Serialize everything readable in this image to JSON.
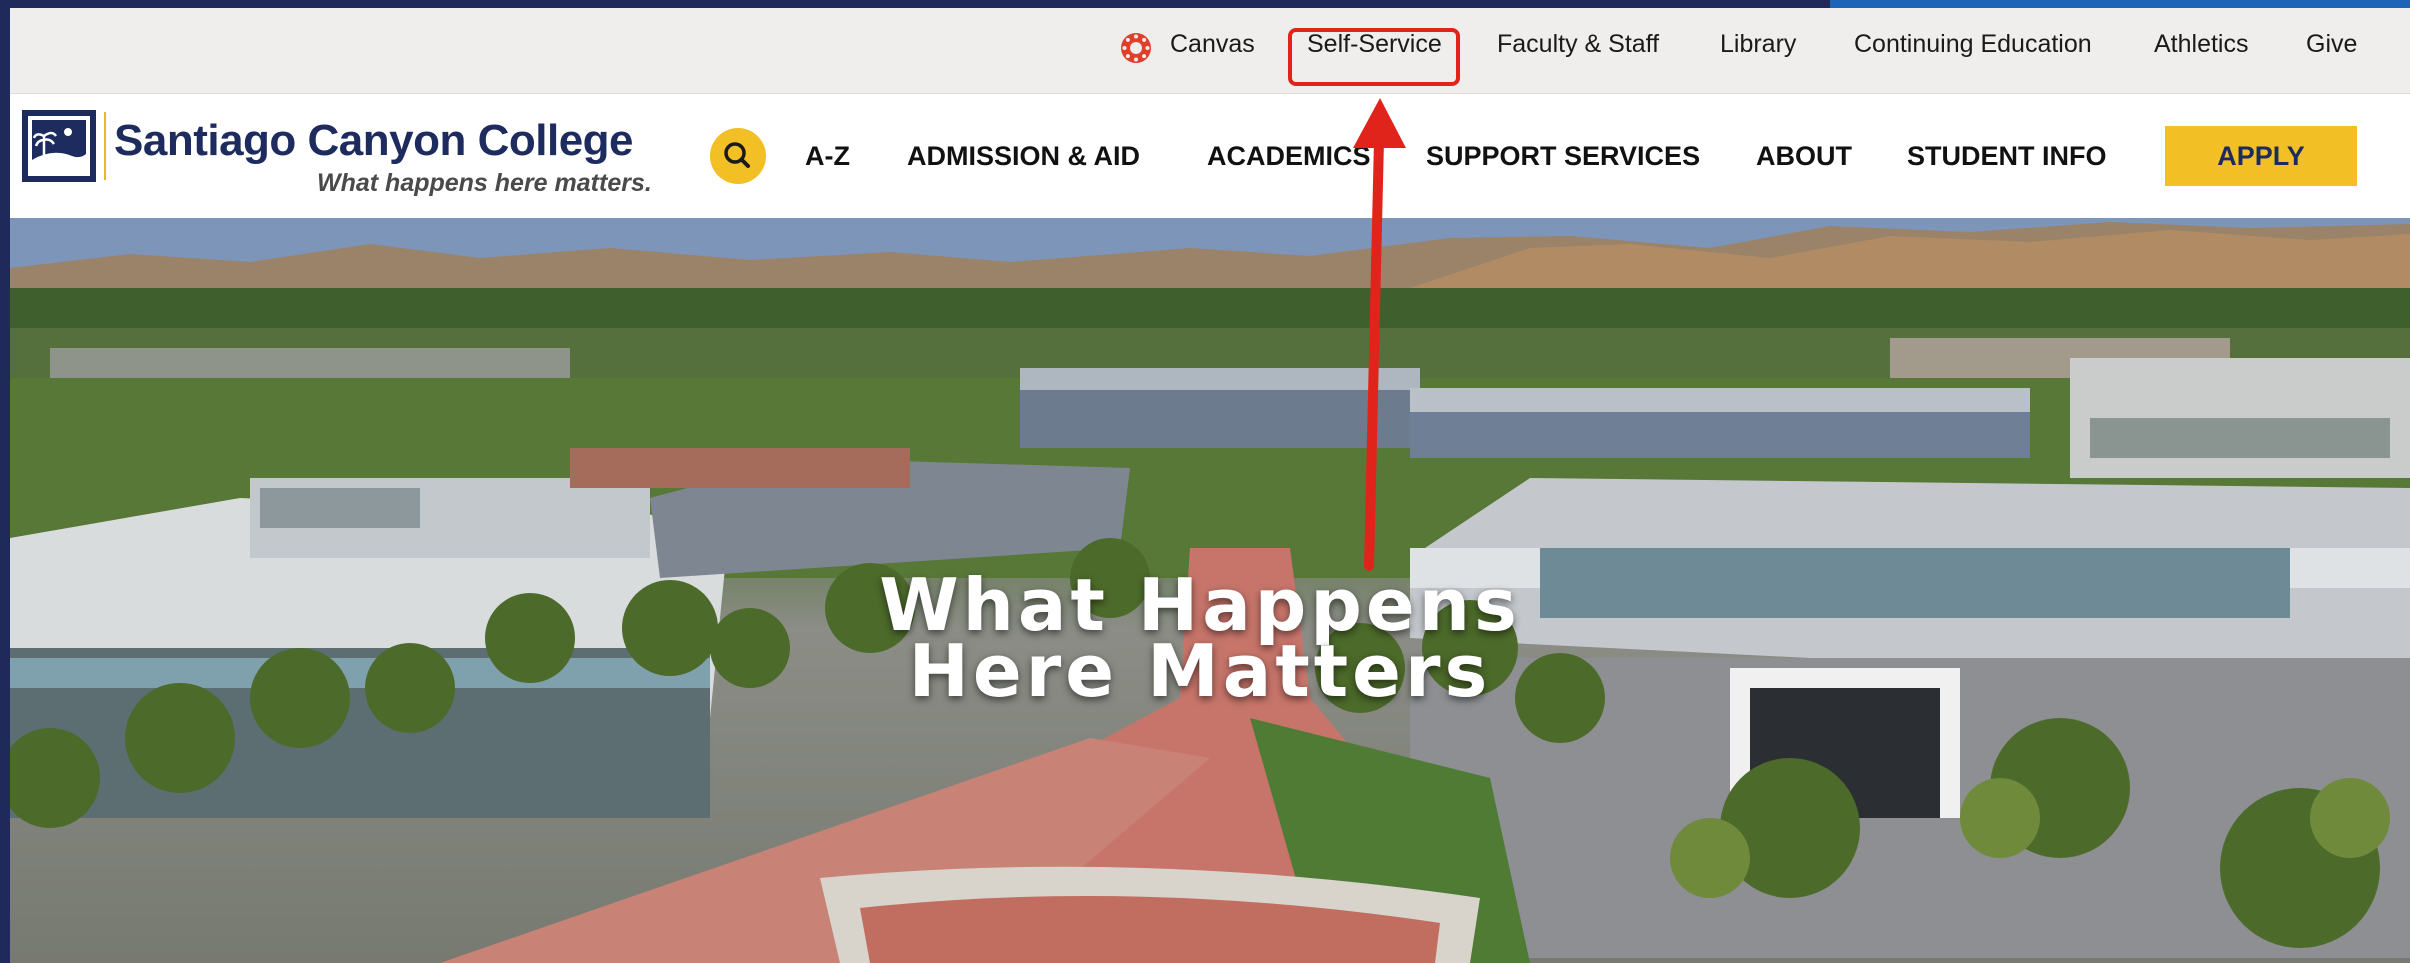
{
  "utility_bar": {
    "items": [
      {
        "label": "Canvas",
        "icon": "canvas-icon"
      },
      {
        "label": "Self-Service",
        "highlighted": true
      },
      {
        "label": "Faculty & Staff"
      },
      {
        "label": "Library"
      },
      {
        "label": "Continuing Education"
      },
      {
        "label": "Athletics"
      },
      {
        "label": "Give"
      }
    ]
  },
  "logo": {
    "name": "Santiago Canyon College",
    "tagline": "What happens here matters."
  },
  "nav": {
    "search_icon": "search-icon",
    "items": [
      {
        "label": "A-Z"
      },
      {
        "label": "ADMISSION & AID"
      },
      {
        "label": "ACADEMICS"
      },
      {
        "label": "SUPPORT SERVICES"
      },
      {
        "label": "ABOUT"
      },
      {
        "label": "STUDENT INFO"
      }
    ],
    "apply_label": "APPLY"
  },
  "hero": {
    "title_line1": "What Happens",
    "title_line2": "Here Matters",
    "image": "aerial-campus-photo"
  },
  "annotation": {
    "type": "arrow",
    "target": "Self-Service",
    "color": "#e0241b"
  },
  "colors": {
    "brand_navy": "#1d2b5e",
    "brand_gold": "#f2c025",
    "utility_bg": "#efeeec",
    "annotation_red": "#e0241b"
  }
}
